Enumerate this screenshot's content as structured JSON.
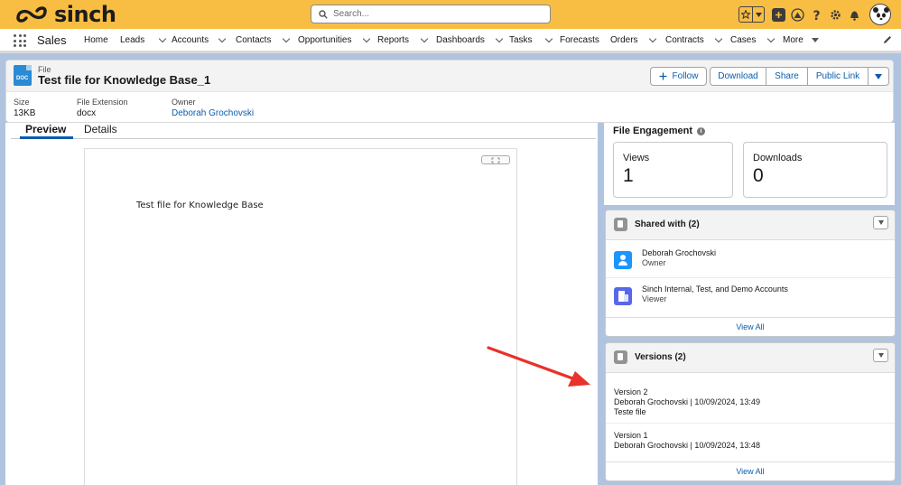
{
  "header": {
    "brand": "sinch",
    "search_placeholder": "Search...",
    "icons": [
      "favorites-star-icon",
      "favorites-dropdown-icon",
      "add-icon",
      "trailhead-icon",
      "help-icon",
      "setup-gear-icon",
      "notifications-bell-icon",
      "user-avatar"
    ]
  },
  "nav": {
    "app_name": "Sales",
    "items": [
      {
        "label": "Home",
        "dropdown": false
      },
      {
        "label": "Leads",
        "dropdown": true
      },
      {
        "label": "Accounts",
        "dropdown": true
      },
      {
        "label": "Contacts",
        "dropdown": true
      },
      {
        "label": "Opportunities",
        "dropdown": true
      },
      {
        "label": "Reports",
        "dropdown": true
      },
      {
        "label": "Dashboards",
        "dropdown": true
      },
      {
        "label": "Tasks",
        "dropdown": true
      },
      {
        "label": "Forecasts",
        "dropdown": false
      },
      {
        "label": "Orders",
        "dropdown": true
      },
      {
        "label": "Contracts",
        "dropdown": true
      },
      {
        "label": "Cases",
        "dropdown": true
      },
      {
        "label": "More",
        "dropdown": true
      }
    ]
  },
  "record": {
    "icon_label": "DOC",
    "object_type": "File",
    "title": "Test file for Knowledge Base_1",
    "actions": {
      "follow": "Follow",
      "download": "Download",
      "share": "Share",
      "public_link": "Public Link"
    },
    "fields": [
      {
        "label": "Size",
        "value": "13KB"
      },
      {
        "label": "File Extension",
        "value": "docx"
      },
      {
        "label": "Owner",
        "value": "Deborah Grochovski"
      }
    ]
  },
  "tabs": {
    "preview": "Preview",
    "details": "Details"
  },
  "preview": {
    "expand_icon": "expand-icon",
    "text": "Test file for Knowledge Base"
  },
  "engagement": {
    "title": "File Engagement",
    "views_label": "Views",
    "views_value": "1",
    "downloads_label": "Downloads",
    "downloads_value": "0"
  },
  "shared_with": {
    "title": "Shared with (2)",
    "items": [
      {
        "name": "Deborah Grochovski",
        "role": "Owner",
        "icon": "user-icon"
      },
      {
        "name": "Sinch Internal, Test, and Demo Accounts",
        "role": "Viewer",
        "icon": "group-icon"
      }
    ],
    "view_all": "View All"
  },
  "versions": {
    "title": "Versions (2)",
    "items": [
      {
        "title": "Version 2",
        "meta": "Deborah Grochovski | 10/09/2024, 13:49",
        "description": "Teste file"
      },
      {
        "title": "Version 1",
        "meta": "Deborah Grochovski | 10/09/2024, 13:48",
        "description": ""
      }
    ],
    "view_all": "View All"
  },
  "colors": {
    "header_bg": "#f8bd43",
    "link": "#0b5cab",
    "annotation_arrow": "#e8322b"
  }
}
